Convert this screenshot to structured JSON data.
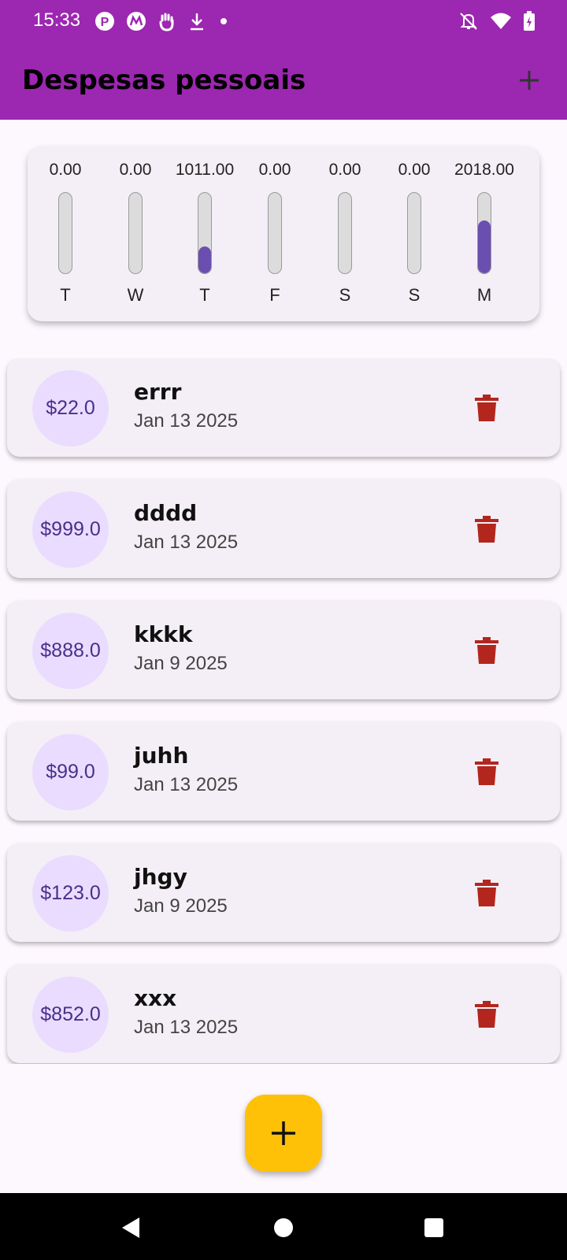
{
  "status_bar": {
    "time": "15:33",
    "left_icons": [
      "pinterest-like-icon",
      "motorola-icon",
      "gesture-icon",
      "download-icon",
      "dot-icon"
    ],
    "right_icons": [
      "bell-off-icon",
      "wifi-icon",
      "battery-charging-icon"
    ]
  },
  "app_bar": {
    "title": "Despesas pessoais",
    "add_icon": "plus-icon",
    "background": "#9c27b0"
  },
  "chart": {
    "bars": [
      {
        "day": "T",
        "value": "0.00",
        "fill": 0.0
      },
      {
        "day": "W",
        "value": "0.00",
        "fill": 0.0
      },
      {
        "day": "T",
        "value": "1011.00",
        "fill": 0.33
      },
      {
        "day": "F",
        "value": "0.00",
        "fill": 0.0
      },
      {
        "day": "S",
        "value": "0.00",
        "fill": 0.0
      },
      {
        "day": "S",
        "value": "0.00",
        "fill": 0.0
      },
      {
        "day": "M",
        "value": "2018.00",
        "fill": 0.66
      }
    ],
    "fill_color": "#6a4fb0"
  },
  "expenses": [
    {
      "amount": "$22.0",
      "title": "errr",
      "date": "Jan 13 2025"
    },
    {
      "amount": "$999.0",
      "title": "dddd",
      "date": "Jan 13 2025"
    },
    {
      "amount": "$888.0",
      "title": "kkkk",
      "date": "Jan 9 2025"
    },
    {
      "amount": "$99.0",
      "title": "juhh",
      "date": "Jan 13 2025"
    },
    {
      "amount": "$123.0",
      "title": "jhgy",
      "date": "Jan 9 2025"
    },
    {
      "amount": "$852.0",
      "title": "xxx",
      "date": "Jan 13 2025"
    }
  ],
  "fab": {
    "icon": "plus-icon",
    "color": "#ffc107"
  },
  "nav_bar": {
    "icons": [
      "back-icon",
      "home-icon",
      "recents-icon"
    ]
  },
  "colors": {
    "trash": "#b3261e",
    "avatar": "#eadcff"
  }
}
